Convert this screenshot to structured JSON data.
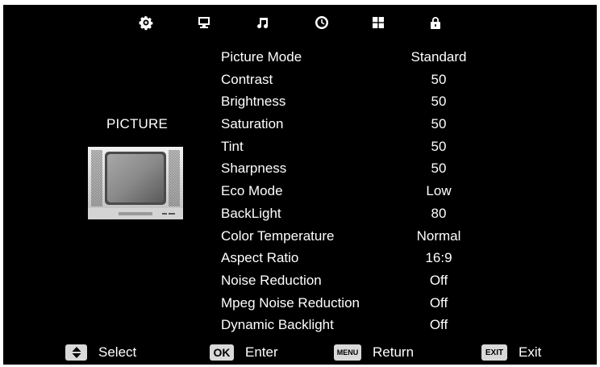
{
  "top_bar": {
    "icons": [
      "gear-icon",
      "monitor-icon",
      "music-note-icon",
      "clock-icon",
      "grid-icon",
      "lock-icon"
    ]
  },
  "left_panel": {
    "title": "PICTURE"
  },
  "menu": {
    "items": [
      {
        "label": "Picture Mode",
        "value": "Standard"
      },
      {
        "label": "Contrast",
        "value": "50"
      },
      {
        "label": "Brightness",
        "value": "50"
      },
      {
        "label": "Saturation",
        "value": "50"
      },
      {
        "label": "Tint",
        "value": "50"
      },
      {
        "label": "Sharpness",
        "value": "50"
      },
      {
        "label": "Eco Mode",
        "value": "Low"
      },
      {
        "label": "BackLight",
        "value": "80"
      },
      {
        "label": "Color Temperature",
        "value": "Normal"
      },
      {
        "label": "Aspect Ratio",
        "value": "16:9"
      },
      {
        "label": "Noise Reduction",
        "value": "Off"
      },
      {
        "label": "Mpeg Noise Reduction",
        "value": "Off"
      },
      {
        "label": "Dynamic Backlight",
        "value": "Off"
      }
    ]
  },
  "hints": {
    "select": {
      "key": "up-down-arrows-icon",
      "label": "Select"
    },
    "enter": {
      "key": "OK",
      "label": "Enter"
    },
    "return": {
      "key": "MENU",
      "label": "Return"
    },
    "exit": {
      "key": "EXIT",
      "label": "Exit"
    }
  },
  "colors": {
    "background": "#000000",
    "text": "#ffffff",
    "key_background": "#d9d9d9"
  }
}
